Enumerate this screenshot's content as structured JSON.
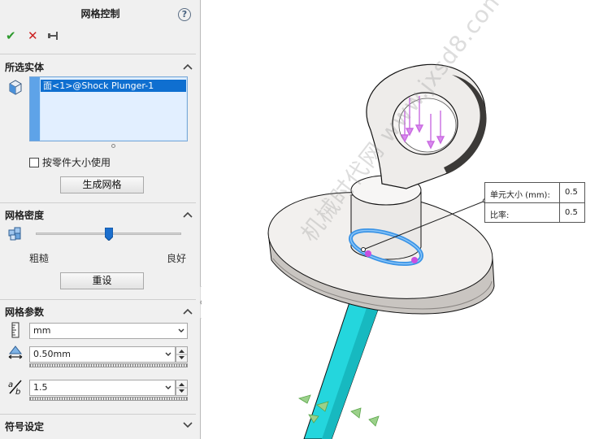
{
  "panel": {
    "title": "网格控制",
    "help_icon": "?",
    "actions": {
      "ok": "✔",
      "cancel": "✕",
      "pin": "pin-icon"
    },
    "selected_entities": {
      "header": "所选实体",
      "items": [
        "面<1>@Shock Plunger-1"
      ],
      "use_part_size_checkbox": {
        "label": "按零件大小使用",
        "checked": false
      },
      "create_mesh_button": "生成网格"
    },
    "mesh_density": {
      "header": "网格密度",
      "slider_value_fraction": 0.5,
      "left_label": "粗糙",
      "right_label": "良好",
      "reset_button": "重设"
    },
    "mesh_parameters": {
      "header": "网格参数",
      "unit_select": "mm",
      "element_size": "0.50mm",
      "ratio": "1.5"
    },
    "symbol_settings": {
      "header": "符号设定"
    }
  },
  "viewport": {
    "callout": {
      "rows": [
        {
          "label": "单元大小 (mm):",
          "value": "0.5"
        },
        {
          "label": "比率:",
          "value": "0.5"
        }
      ]
    },
    "watermark": "机械时代网 www.jxsd8.com",
    "colors": {
      "shaft": "#24d6dd",
      "selected_face": "#3b94e6",
      "handle": "#c94fe0",
      "body": "#f2f0ee"
    }
  }
}
